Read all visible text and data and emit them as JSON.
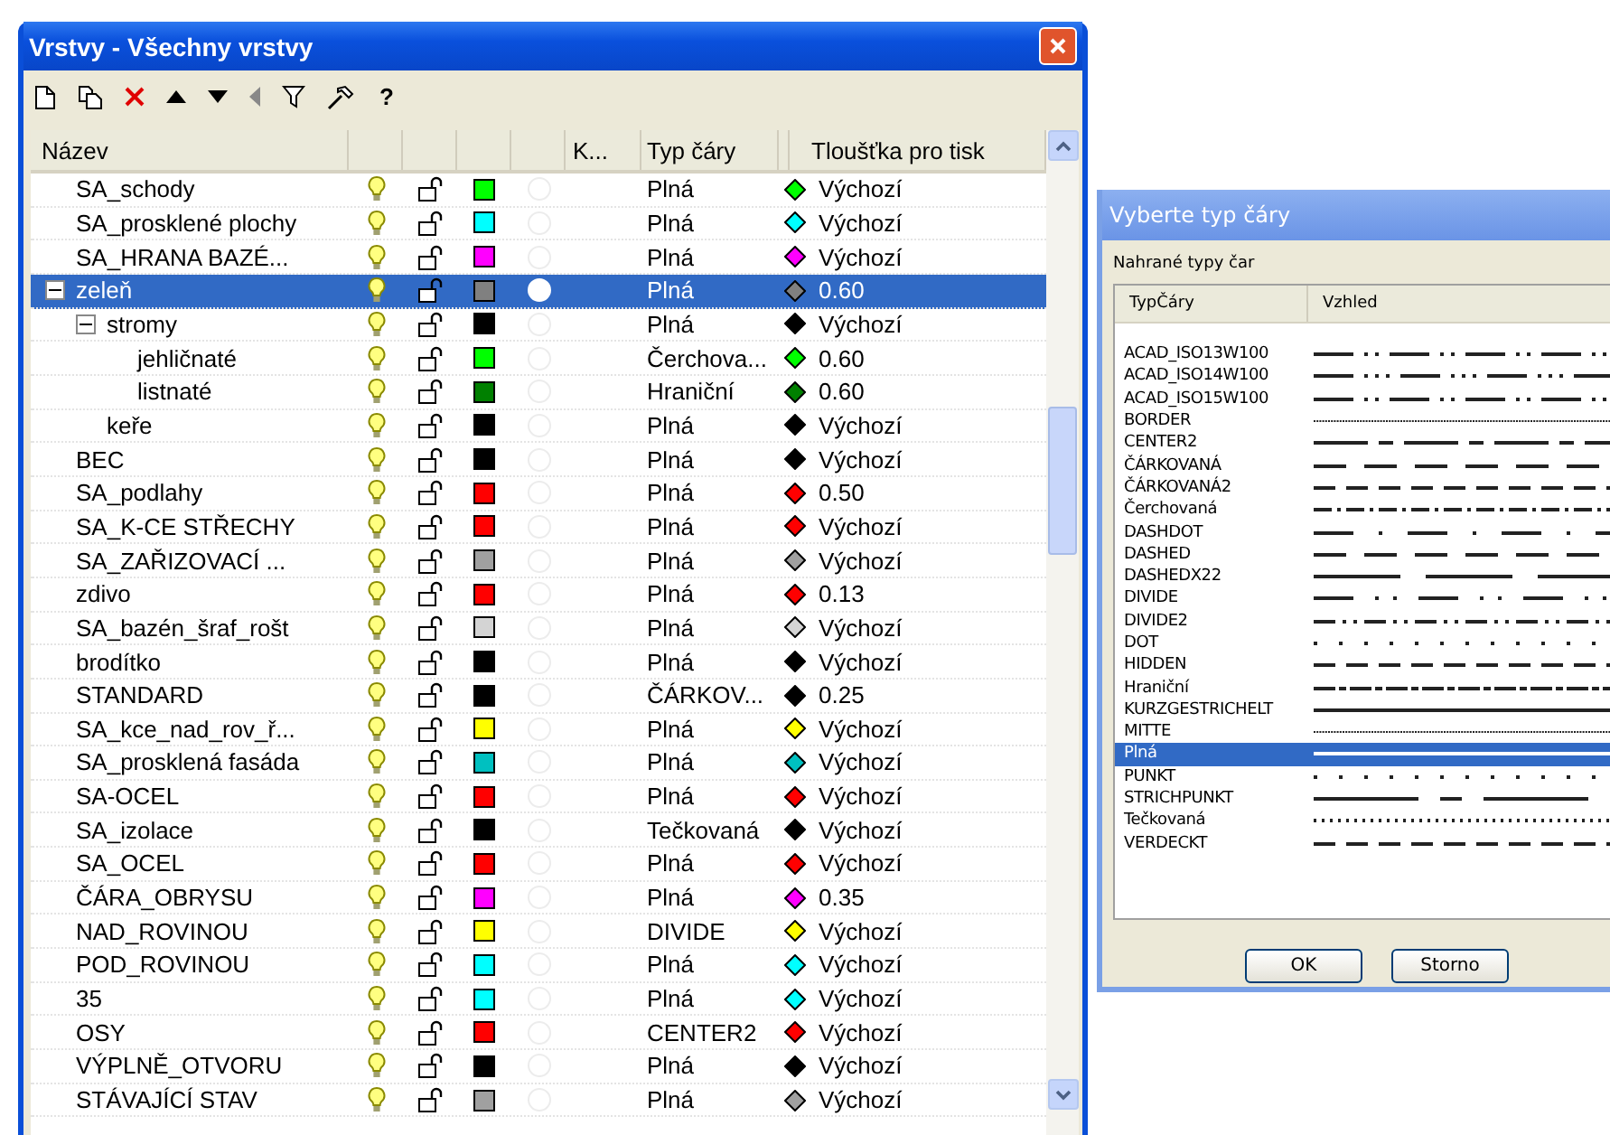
{
  "window": {
    "title": "Vrstvy - Všechny vrstvy"
  },
  "toolbar": [
    "?"
  ],
  "columns": [
    {
      "kind": "name",
      "label": "Název"
    },
    {
      "kind": "k",
      "label": "K..."
    },
    {
      "kind": "linetype",
      "label": "Typ čáry"
    },
    {
      "kind": "thickness",
      "label": "Tloušťka pro tisk"
    }
  ],
  "layers": [
    {
      "name": "SA_schody",
      "color": "#00ff00",
      "linetype": "Plná",
      "thickness": "Výchozí",
      "selected": false,
      "current": false
    },
    {
      "name": "SA_prosklené plochy",
      "color": "#00ffff",
      "linetype": "Plná",
      "thickness": "Výchozí",
      "selected": false,
      "current": false
    },
    {
      "name": "SA_HRANA BAZÉ...",
      "color": "#ff00ff",
      "linetype": "Plná",
      "thickness": "Výchozí",
      "selected": false,
      "current": false
    },
    {
      "name": "zeleň",
      "color": "#808080",
      "linetype": "Plná",
      "thickness": "0.60",
      "selected": true,
      "current": true,
      "expanded": true,
      "children": [
        {
          "name": "stromy",
          "color": "#000000",
          "linetype": "Plná",
          "thickness": "Výchozí",
          "selected": false,
          "current": false,
          "expanded": true,
          "children": [
            {
              "name": "jehličnaté",
              "color": "#00ff00",
              "linetype": "Čerchova...",
              "thickness": "0.60",
              "selected": false,
              "current": false
            },
            {
              "name": "listnaté",
              "color": "#008000",
              "linetype": "Hraniční",
              "thickness": "0.60",
              "selected": false,
              "current": false
            }
          ]
        },
        {
          "name": "keře",
          "color": "#000000",
          "linetype": "Plná",
          "thickness": "Výchozí",
          "selected": false,
          "current": false
        }
      ]
    },
    {
      "name": "BEC",
      "color": "#000000",
      "linetype": "Plná",
      "thickness": "Výchozí",
      "selected": false,
      "current": false
    },
    {
      "name": "SA_podlahy",
      "color": "#ff0000",
      "linetype": "Plná",
      "thickness": "0.50",
      "selected": false,
      "current": false
    },
    {
      "name": "SA_K-CE STŘECHY",
      "color": "#ff0000",
      "linetype": "Plná",
      "thickness": "Výchozí",
      "selected": false,
      "current": false
    },
    {
      "name": "SA_ZAŘIZOVACÍ ...",
      "color": "#a0a0a0",
      "linetype": "Plná",
      "thickness": "Výchozí",
      "selected": false,
      "current": false
    },
    {
      "name": "zdivo",
      "color": "#ff0000",
      "linetype": "Plná",
      "thickness": "0.13",
      "selected": false,
      "current": false
    },
    {
      "name": "SA_bazén_šraf_rošt",
      "color": "#d4d4d4",
      "linetype": "Plná",
      "thickness": "Výchozí",
      "selected": false,
      "current": false
    },
    {
      "name": "brodítko",
      "color": "#000000",
      "linetype": "Plná",
      "thickness": "Výchozí",
      "selected": false,
      "current": false
    },
    {
      "name": "STANDARD",
      "color": "#000000",
      "linetype": "ČÁRKOV...",
      "thickness": "0.25",
      "selected": false,
      "current": false
    },
    {
      "name": "SA_kce_nad_rov_ř...",
      "color": "#ffff00",
      "linetype": "Plná",
      "thickness": "Výchozí",
      "selected": false,
      "current": false
    },
    {
      "name": "SA_prosklená fasáda",
      "color": "#00c0c0",
      "linetype": "Plná",
      "thickness": "Výchozí",
      "selected": false,
      "current": false
    },
    {
      "name": "SA-OCEL",
      "color": "#ff0000",
      "linetype": "Plná",
      "thickness": "Výchozí",
      "selected": false,
      "current": false
    },
    {
      "name": "SA_izolace",
      "color": "#000000",
      "linetype": "Tečkovaná",
      "thickness": "Výchozí",
      "selected": false,
      "current": false
    },
    {
      "name": "SA_OCEL",
      "color": "#ff0000",
      "linetype": "Plná",
      "thickness": "Výchozí",
      "selected": false,
      "current": false
    },
    {
      "name": "ČÁRA_OBRYSU",
      "color": "#ff00ff",
      "linetype": "Plná",
      "thickness": "0.35",
      "selected": false,
      "current": false
    },
    {
      "name": "NAD_ROVINOU",
      "color": "#ffff00",
      "linetype": "DIVIDE",
      "thickness": "Výchozí",
      "selected": false,
      "current": false
    },
    {
      "name": "POD_ROVINOU",
      "color": "#00ffff",
      "linetype": "Plná",
      "thickness": "Výchozí",
      "selected": false,
      "current": false
    },
    {
      "name": "35",
      "color": "#00ffff",
      "linetype": "Plná",
      "thickness": "Výchozí",
      "selected": false,
      "current": false
    },
    {
      "name": "OSY",
      "color": "#ff0000",
      "linetype": "CENTER2",
      "thickness": "Výchozí",
      "selected": false,
      "current": false
    },
    {
      "name": "VÝPLNĚ_OTVORU",
      "color": "#000000",
      "linetype": "Plná",
      "thickness": "Výchozí",
      "selected": false,
      "current": false
    },
    {
      "name": "STÁVAJÍCÍ STAV",
      "color": "#a0a0a0",
      "linetype": "Plná",
      "thickness": "Výchozí",
      "selected": false,
      "current": false
    }
  ],
  "dialog": {
    "title": "Vyberte typ čáry",
    "group_label": "Nahrané typy čar",
    "columns": [
      "TypČáry",
      "Vzhled"
    ],
    "linetypes": [
      {
        "name": "ACAD_ISO13W100",
        "kind": "dashdotdot",
        "selected": false
      },
      {
        "name": "ACAD_ISO14W100",
        "kind": "dashdots",
        "selected": false
      },
      {
        "name": "ACAD_ISO15W100",
        "kind": "dashdotdot",
        "selected": false
      },
      {
        "name": "BORDER",
        "kind": "fine",
        "selected": false
      },
      {
        "name": "CENTER2",
        "kind": "center",
        "selected": false
      },
      {
        "name": "ČÁRKOVANÁ",
        "kind": "dashed",
        "selected": false
      },
      {
        "name": "ČÁRKOVANÁ2",
        "kind": "shortdash",
        "selected": false
      },
      {
        "name": "Čerchovaná",
        "kind": "dashdot",
        "selected": false
      },
      {
        "name": "DASHDOT",
        "kind": "widedashdot",
        "selected": false
      },
      {
        "name": "DASHED",
        "kind": "dashed",
        "selected": false
      },
      {
        "name": "DASHEDX22",
        "kind": "longdash",
        "selected": false
      },
      {
        "name": "DIVIDE",
        "kind": "divide",
        "selected": false
      },
      {
        "name": "DIVIDE2",
        "kind": "divide2",
        "selected": false
      },
      {
        "name": "DOT",
        "kind": "dot",
        "selected": false
      },
      {
        "name": "HIDDEN",
        "kind": "shortdash",
        "selected": false
      },
      {
        "name": "Hraniční",
        "kind": "border",
        "selected": false
      },
      {
        "name": "KURZGESTRICHELT",
        "kind": "solid",
        "selected": false
      },
      {
        "name": "MITTE",
        "kind": "fine",
        "selected": false
      },
      {
        "name": "Plná",
        "kind": "solid",
        "selected": true
      },
      {
        "name": "PUNKT",
        "kind": "dot",
        "selected": false
      },
      {
        "name": "STRICHPUNKT",
        "kind": "strich",
        "selected": false
      },
      {
        "name": "Tečkovaná",
        "kind": "dense",
        "selected": false
      },
      {
        "name": "VERDECKT",
        "kind": "shortdash",
        "selected": false
      }
    ],
    "buttons": [
      "OK",
      "Storno"
    ]
  }
}
